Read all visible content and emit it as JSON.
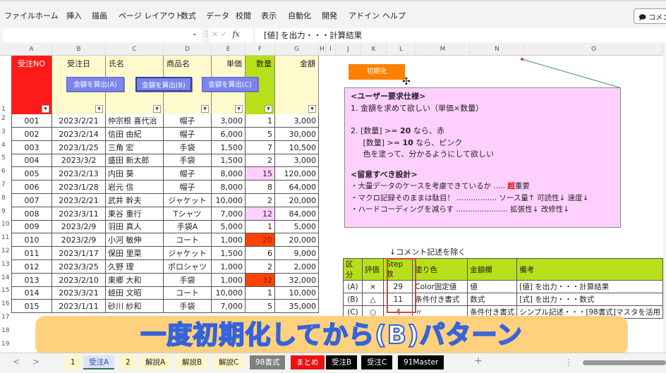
{
  "ribbon": {
    "menu": [
      "ファイル",
      "ホーム",
      "挿入",
      "描画",
      "ページ レイアウト",
      "数式",
      "データ",
      "校閲",
      "表示",
      "自動化",
      "開発",
      "アドイン",
      "ヘルプ"
    ],
    "comment_button": "コメント"
  },
  "formula_bar": {
    "name_box": "",
    "fx_label": "fx",
    "cancel_icon": "✕",
    "confirm_icon": "✓",
    "formula": "[値] を出力・・・計算結果"
  },
  "columns": [
    "A",
    "B",
    "C",
    "D",
    "E",
    "F",
    "G",
    "H",
    "I",
    "J",
    "K",
    "L",
    "M",
    "N",
    "O"
  ],
  "rows": [
    "1",
    "2",
    "3",
    "4",
    "5",
    "6",
    "7",
    "8",
    "9",
    "10",
    "11",
    "12",
    "13",
    "14",
    "15",
    "16",
    "17",
    "18",
    "19"
  ],
  "table": {
    "headers": [
      "受注NO",
      "受注日",
      "氏名",
      "商品名",
      "単価",
      "数量",
      "金額"
    ],
    "header_colors": {
      "order_no": "#ff1a1a",
      "default": "#fffacd",
      "qty": "#b8e01a"
    },
    "rows": [
      [
        "001",
        "2023/2/21",
        "仲宗根 喜代治",
        "帽子",
        "3,000",
        "1",
        "3,000"
      ],
      [
        "002",
        "2023/2/14",
        "信田 由紀",
        "帽子",
        "6,000",
        "5",
        "30,000"
      ],
      [
        "003",
        "2023/1/25",
        "三角 宏",
        "手袋",
        "1,500",
        "7",
        "10,500"
      ],
      [
        "004",
        "2023/3/2",
        "盛田 新太郎",
        "手袋",
        "1,500",
        "2",
        "3,000"
      ],
      [
        "005",
        "2023/2/13",
        "内田 葵",
        "帽子",
        "8,000",
        "15",
        "120,000"
      ],
      [
        "006",
        "2023/1/28",
        "岩元 信",
        "帽子",
        "8,000",
        "8",
        "64,000"
      ],
      [
        "007",
        "2023/2/21",
        "武井 幹夫",
        "ジャケット",
        "10,000",
        "2",
        "20,000"
      ],
      [
        "008",
        "2023/3/11",
        "東谷 重行",
        "Tシャツ",
        "7,000",
        "12",
        "84,000"
      ],
      [
        "009",
        "2023/2/9",
        "羽田 真人",
        "手袋A",
        "5,000",
        "1",
        "5,000"
      ],
      [
        "010",
        "2023/2/9",
        "小河 敏伸",
        "コート",
        "1,000",
        "20",
        "20,000"
      ],
      [
        "011",
        "2023/1/17",
        "保田 里菜",
        "ジャケット",
        "1,500",
        "6",
        "9,000"
      ],
      [
        "012",
        "2023/3/25",
        "久野 理",
        "ポロシャツ",
        "1,000",
        "2",
        "2,000"
      ],
      [
        "013",
        "2023/2/10",
        "東郷 大和",
        "手袋",
        "1,000",
        "32",
        "32,000"
      ],
      [
        "014",
        "2023/3/21",
        "蛭田 文昭",
        "コート",
        "10,000",
        "1",
        "10,000"
      ],
      [
        "015",
        "2023/1/11",
        "砂川 紗和",
        "手袋",
        "7,000",
        "5",
        "35,000"
      ]
    ],
    "qty_highlight": {
      "pink": "#ffd0ff",
      "red": "#ff4400"
    }
  },
  "buttons": {
    "calc_a": "金額を算出(A)",
    "calc_b": "金額を算出(B)",
    "calc_c": "金額を算出(C)",
    "init": "初期化"
  },
  "spec": {
    "title": "<ユーザー要求仕様>",
    "line1": "1.  金額を求めて欲しい（単価×数量）",
    "line2_prefix": "2.   [数量] >= ",
    "line2_num": "20",
    "line2_suffix": " なら、赤",
    "line3_prefix": "     [数量] >= ",
    "line3_num": "10",
    "line3_suffix": " なら、ピンク",
    "line4": "     色を塗って、分かるようにして欲しい",
    "design_title": "<留意すべき設計>",
    "design1_prefix": "・大量データのケースを考慮できているか ..... ",
    "design1_emph": "超",
    "design1_suffix": "重要",
    "design2": "・マクロ記録そのままは駄目！ ................. ソース量↑ 可読性↓ 速度↓",
    "design3": "・ハードコーディングを減らす ...................... 拡張性↓  改修性↓"
  },
  "summary": {
    "note": "↓コメント記述を除く",
    "headers": [
      "区分",
      "評価",
      "Step数",
      "塗り色",
      "金額欄",
      "備考"
    ],
    "rows": [
      [
        "(A)",
        "×",
        "29",
        "Color固定値",
        "値",
        "[値] を出力・・・計算結果"
      ],
      [
        "(B)",
        "△",
        "11",
        "条件付き書式",
        "数式",
        "[式] を出力・・・数式"
      ],
      [
        "(C)",
        "○",
        "4",
        "〃",
        "条件付き書式",
        "シンプル記述・・・[98書式]マスタを活用"
      ]
    ]
  },
  "caption": "一度初期化してから(B)パターン",
  "sheet_tabs": [
    {
      "label": "1",
      "bg": "#fff6c8",
      "fg": "#222"
    },
    {
      "label": "受注A",
      "bg": "#dde3f7",
      "fg": "#2a4da8"
    },
    {
      "label": "2",
      "bg": "#fff6c8",
      "fg": "#222"
    },
    {
      "label": "解説A",
      "bg": "#fff6c8",
      "fg": "#222"
    },
    {
      "label": "解説B",
      "bg": "#fff6c8",
      "fg": "#222"
    },
    {
      "label": "解説C",
      "bg": "#fff6c8",
      "fg": "#222"
    },
    {
      "label": "98書式",
      "bg": "#808080",
      "fg": "#fff"
    },
    {
      "label": "まとめ",
      "bg": "#ee1111",
      "fg": "#fff"
    },
    {
      "label": "受注B",
      "bg": "#000000",
      "fg": "#fff"
    },
    {
      "label": "受注C",
      "bg": "#000000",
      "fg": "#fff"
    },
    {
      "label": "91Master",
      "bg": "#000000",
      "fg": "#fff"
    }
  ],
  "add_sheet": "+",
  "nav": {
    "prev": "<",
    "next": ">"
  }
}
